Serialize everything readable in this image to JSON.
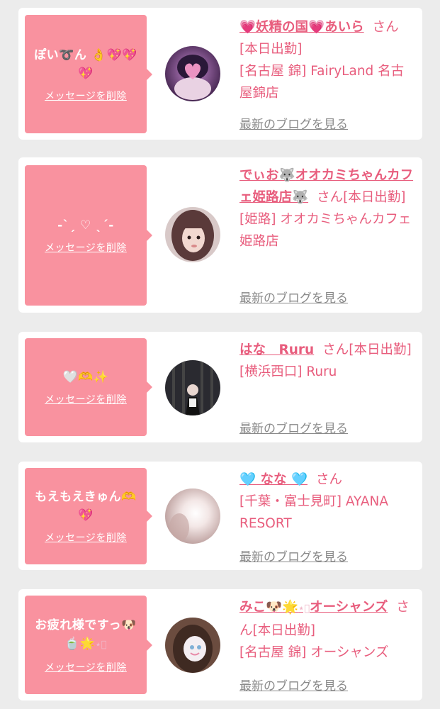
{
  "cards": [
    {
      "message_line1": "ぽい",
      "message_line2": "",
      "delete_label": "メッセージを削除",
      "name": "妖精の国",
      "name2": "あいら",
      "san": "さん",
      "status": "[本日出勤]",
      "shop": "[名古屋 錦] FairyLand 名古屋錦店",
      "blog_label": "最新のブログを見る"
    },
    {
      "message": "-ˋˏ ♡ ˎˊ-",
      "delete_label": "メッセージを削除",
      "name": "でぃお",
      "name2": "オオカミちゃんカフェ姫路店",
      "san": "さん",
      "status": "[本日出勤]",
      "shop": "[姫路] オオカミちゃんカフェ姫路店",
      "blog_label": "最新のブログを見る"
    },
    {
      "message": "",
      "delete_label": "メッセージを削除",
      "name": "はな　Ruru",
      "san": "さん",
      "status": "[本日出勤]",
      "shop": "[横浜西口] Ruru",
      "blog_label": "最新のブログを見る"
    },
    {
      "message": "もえもえきゅん",
      "delete_label": "メッセージを削除",
      "name": "なな",
      "san": "さん",
      "shop": "[千葉・富士見町] AYANA RESORT",
      "blog_label": "最新のブログを見る"
    },
    {
      "message": "お疲れ様ですっ",
      "delete_label": "メッセージを削除",
      "name": "みこ",
      "name2": "オーシャンズ",
      "san": "さん",
      "status": "[本日出勤]",
      "shop": "[名古屋 錦] オーシャンズ",
      "blog_label": "最新のブログを見る"
    }
  ],
  "colors": {
    "bubble": "#f9929f",
    "name": "#e85d7d",
    "link_gray": "#8a8a8a",
    "background": "#ececec"
  }
}
